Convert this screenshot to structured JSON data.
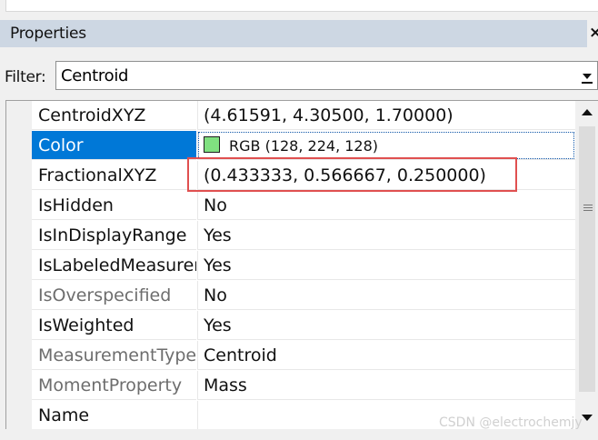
{
  "panel": {
    "title": "Properties",
    "close_glyph": "×"
  },
  "filter": {
    "label": "Filter:",
    "value": "Centroid"
  },
  "properties": [
    {
      "name": "CentroidXYZ",
      "value": "(4.61591, 4.30500, 1.70000)"
    },
    {
      "name": "Color",
      "value": "RGB (128, 224, 128)",
      "swatch_color": "#80e080"
    },
    {
      "name": "FractionalXYZ",
      "value": "(0.433333, 0.566667, 0.250000)"
    },
    {
      "name": "IsHidden",
      "value": "No"
    },
    {
      "name": "IsInDisplayRange",
      "value": "Yes"
    },
    {
      "name": "IsLabeledMeasurement",
      "value": "Yes"
    },
    {
      "name": "IsOverspecified",
      "value": "No"
    },
    {
      "name": "IsWeighted",
      "value": "Yes"
    },
    {
      "name": "MeasurementType",
      "value": "Centroid"
    },
    {
      "name": "MomentProperty",
      "value": "Mass"
    },
    {
      "name": "Name",
      "value": ""
    }
  ],
  "selected_property": "Color",
  "highlighted_property": "FractionalXYZ",
  "watermark": "CSDN @electrochemjy",
  "colors": {
    "header_bg": "#cdd7e3",
    "selection_bg": "#0078d7",
    "highlight_border": "#e05050",
    "disabled_text": "#6d6d6d"
  },
  "icons": {
    "filter_dropdown": "chevron-down-icon",
    "scroll_up": "arrow-up-icon",
    "scroll_down": "arrow-down-icon",
    "scroll_grip": "grip-icon"
  }
}
